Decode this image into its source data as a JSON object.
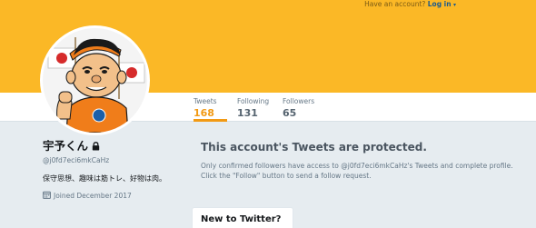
{
  "topbar": {
    "prompt": "Have an account?",
    "login_label": "Log in",
    "caret": "▾"
  },
  "stats": {
    "tweets": {
      "label": "Tweets",
      "value": "168"
    },
    "following": {
      "label": "Following",
      "value": "131"
    },
    "followers": {
      "label": "Followers",
      "value": "65"
    }
  },
  "profile": {
    "name": "宇予くん",
    "handle": "@j0fd7eci6mkCaHz",
    "bio": "保守思想、趣味は筋トレ、好物は肉。",
    "joined": "Joined December 2017"
  },
  "protected": {
    "title": "This account's Tweets are protected.",
    "message": "Only confirmed followers have access to @j0fd7eci6mkCaHz's Tweets and complete profile. Click the \"Follow\" button to send a follow request."
  },
  "signup_card": {
    "title": "New to Twitter?"
  },
  "colors": {
    "header": "#fbb826",
    "accent": "#f29a14",
    "background": "#e6ecf0",
    "link": "#1b5a8c"
  },
  "icons": [
    "lock-icon",
    "calendar-icon",
    "caret-down-icon"
  ]
}
